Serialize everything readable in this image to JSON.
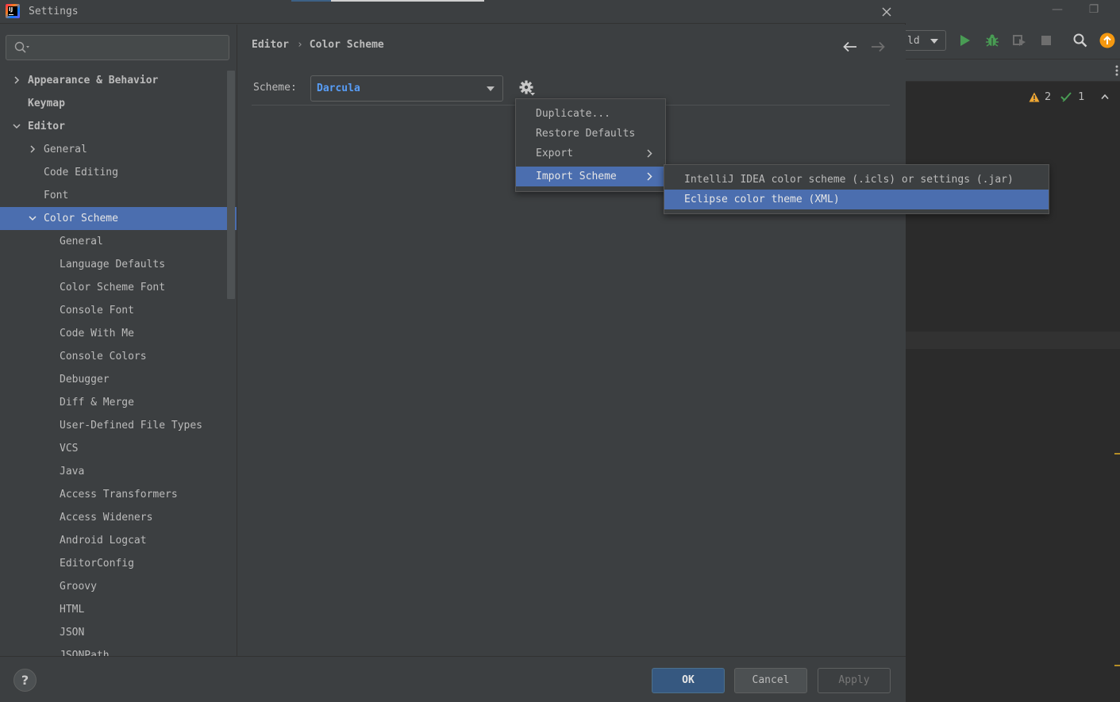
{
  "dialog": {
    "title": "Settings"
  },
  "search": {
    "placeholder": ""
  },
  "tree": [
    {
      "label": "Appearance & Behavior",
      "level": 0,
      "chevron": "right",
      "bold": true,
      "selected": false
    },
    {
      "label": "Keymap",
      "level": 0,
      "chevron": "none",
      "bold": true,
      "selected": false
    },
    {
      "label": "Editor",
      "level": 0,
      "chevron": "down",
      "bold": true,
      "selected": false
    },
    {
      "label": "General",
      "level": 1,
      "chevron": "right",
      "bold": false,
      "selected": false
    },
    {
      "label": "Code Editing",
      "level": 1,
      "chevron": "none",
      "bold": false,
      "selected": false
    },
    {
      "label": "Font",
      "level": 1,
      "chevron": "none",
      "bold": false,
      "selected": false
    },
    {
      "label": "Color Scheme",
      "level": 1,
      "chevron": "down",
      "bold": false,
      "selected": true
    },
    {
      "label": "General",
      "level": 2,
      "chevron": "none",
      "bold": false,
      "selected": false
    },
    {
      "label": "Language Defaults",
      "level": 2,
      "chevron": "none",
      "bold": false,
      "selected": false
    },
    {
      "label": "Color Scheme Font",
      "level": 2,
      "chevron": "none",
      "bold": false,
      "selected": false
    },
    {
      "label": "Console Font",
      "level": 2,
      "chevron": "none",
      "bold": false,
      "selected": false
    },
    {
      "label": "Code With Me",
      "level": 2,
      "chevron": "none",
      "bold": false,
      "selected": false
    },
    {
      "label": "Console Colors",
      "level": 2,
      "chevron": "none",
      "bold": false,
      "selected": false
    },
    {
      "label": "Debugger",
      "level": 2,
      "chevron": "none",
      "bold": false,
      "selected": false
    },
    {
      "label": "Diff & Merge",
      "level": 2,
      "chevron": "none",
      "bold": false,
      "selected": false
    },
    {
      "label": "User-Defined File Types",
      "level": 2,
      "chevron": "none",
      "bold": false,
      "selected": false
    },
    {
      "label": "VCS",
      "level": 2,
      "chevron": "none",
      "bold": false,
      "selected": false
    },
    {
      "label": "Java",
      "level": 2,
      "chevron": "none",
      "bold": false,
      "selected": false
    },
    {
      "label": "Access Transformers",
      "level": 2,
      "chevron": "none",
      "bold": false,
      "selected": false
    },
    {
      "label": "Access Wideners",
      "level": 2,
      "chevron": "none",
      "bold": false,
      "selected": false
    },
    {
      "label": "Android Logcat",
      "level": 2,
      "chevron": "none",
      "bold": false,
      "selected": false
    },
    {
      "label": "EditorConfig",
      "level": 2,
      "chevron": "none",
      "bold": false,
      "selected": false
    },
    {
      "label": "Groovy",
      "level": 2,
      "chevron": "none",
      "bold": false,
      "selected": false
    },
    {
      "label": "HTML",
      "level": 2,
      "chevron": "none",
      "bold": false,
      "selected": false
    },
    {
      "label": "JSON",
      "level": 2,
      "chevron": "none",
      "bold": false,
      "selected": false
    },
    {
      "label": "JSONPath",
      "level": 2,
      "chevron": "none",
      "bold": false,
      "selected": false
    }
  ],
  "breadcrumb": {
    "parent": "Editor",
    "separator": "›",
    "current": "Color Scheme"
  },
  "scheme": {
    "label": "Scheme:",
    "value": "Darcula"
  },
  "gear_menu": [
    {
      "label": "Duplicate...",
      "submenu": false,
      "selected": false
    },
    {
      "label": "Restore Defaults",
      "submenu": false,
      "selected": false
    },
    {
      "label": "Export",
      "submenu": true,
      "selected": false
    },
    {
      "label": "Import Scheme",
      "submenu": true,
      "selected": true
    }
  ],
  "import_submenu": [
    {
      "label": "IntelliJ IDEA color scheme (.icls) or settings (.jar)",
      "selected": false
    },
    {
      "label": "Eclipse color theme (XML)",
      "selected": true
    }
  ],
  "buttons": {
    "ok": "OK",
    "cancel": "Cancel",
    "apply": "Apply",
    "help": "?"
  },
  "ide": {
    "build_combo": "ld",
    "warnings_count": "2",
    "checks_count": "1"
  },
  "colors": {
    "selection": "#4b6eaf",
    "link": "#589df6",
    "run": "#499c54",
    "warning": "#f0a732",
    "update_badge": "#f49810"
  }
}
